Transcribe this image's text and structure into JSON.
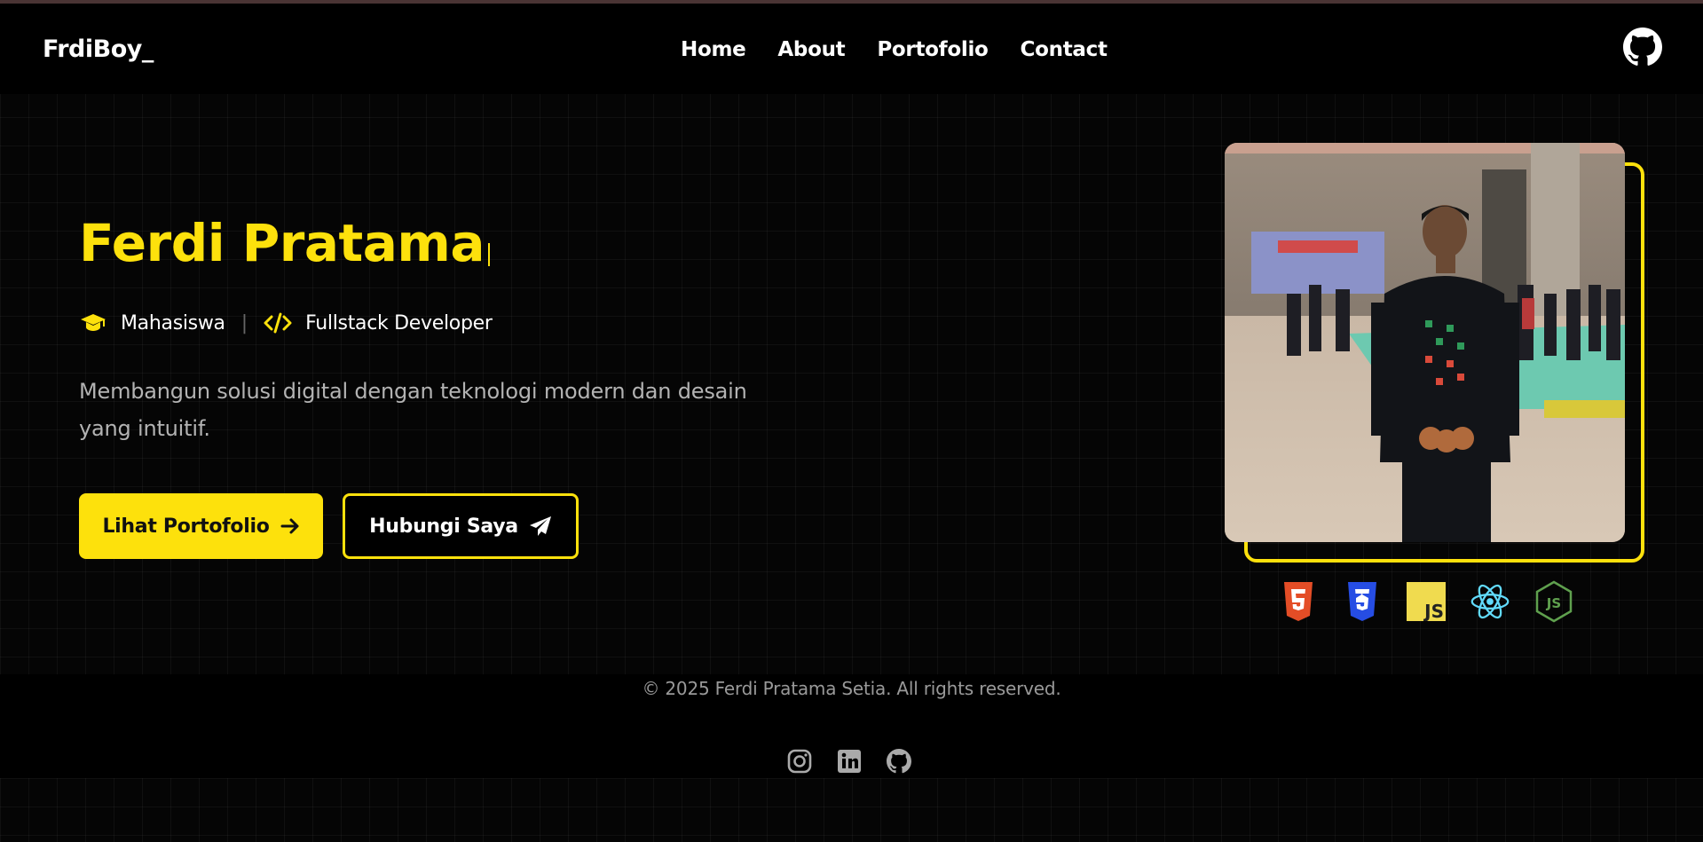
{
  "nav": {
    "brand": "FrdiBoy_",
    "links": [
      "Home",
      "About",
      "Portofolio",
      "Contact"
    ],
    "github_icon": "github-icon"
  },
  "hero": {
    "name": "Ferdi Pratama",
    "roles": [
      {
        "icon": "graduation-cap-icon",
        "label": "Mahasiswa"
      },
      {
        "icon": "code-icon",
        "label": "Fullstack Developer"
      }
    ],
    "role_separator": "|",
    "tagline": "Membangun solusi digital dengan teknologi modern dan desain yang intuitif.",
    "primary_button": "Lihat Portofolio",
    "secondary_button": "Hubungi Saya",
    "tech_icons": [
      "html5-icon",
      "css3-icon",
      "javascript-icon",
      "react-icon",
      "nodejs-icon"
    ]
  },
  "footer": {
    "copyright": "© 2025 Ferdi Pratama Setia. All rights reserved.",
    "social_icons": [
      "instagram-icon",
      "linkedin-icon",
      "github-icon"
    ]
  },
  "colors": {
    "accent": "#fde10c",
    "background": "#000000",
    "muted_text": "#b3b3b3"
  }
}
